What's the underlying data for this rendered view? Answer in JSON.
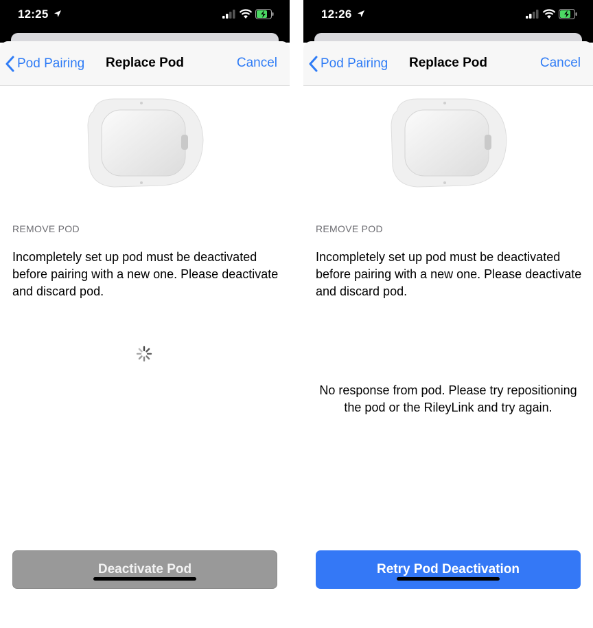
{
  "colors": {
    "accent": "#2f7cf6",
    "button_enabled": "#3478f6",
    "button_disabled": "#999999"
  },
  "screens": [
    {
      "status": {
        "time": "12:25"
      },
      "nav": {
        "back_label": "Pod Pairing",
        "title": "Replace Pod",
        "cancel_label": "Cancel"
      },
      "section_header": "REMOVE POD",
      "instructions": "Incompletely set up pod must be deactivated before pairing with a new one. Please deactivate and discard pod.",
      "state": "loading",
      "button": {
        "label": "Deactivate Pod",
        "enabled": false
      }
    },
    {
      "status": {
        "time": "12:26"
      },
      "nav": {
        "back_label": "Pod Pairing",
        "title": "Replace Pod",
        "cancel_label": "Cancel"
      },
      "section_header": "REMOVE POD",
      "instructions": "Incompletely set up pod must be deactivated before pairing with a new one. Please deactivate and discard pod.",
      "error_message": "No response from pod. Please try repositioning the pod or the RileyLink and try again.",
      "state": "error",
      "button": {
        "label": "Retry Pod Deactivation",
        "enabled": true
      }
    }
  ]
}
